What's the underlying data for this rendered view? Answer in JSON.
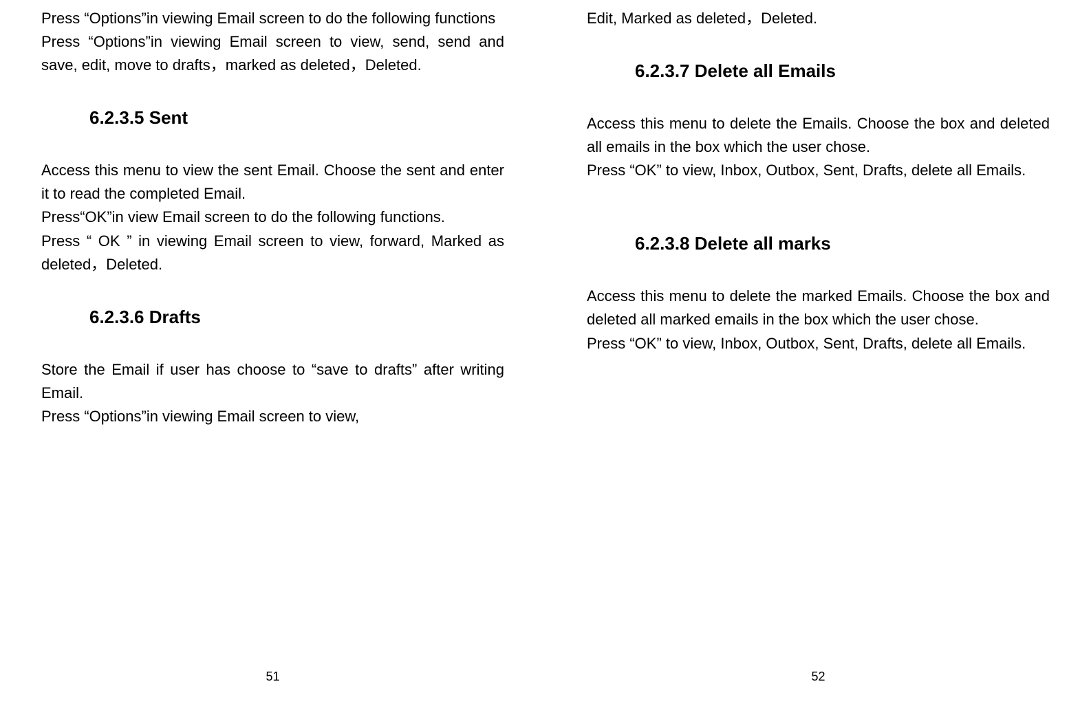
{
  "leftPage": {
    "para1": "Press “Options”in viewing Email screen to do the following functions",
    "para2": "Press “Options”in viewing Email screen to view, send, send and save, edit, move to drafts，marked as deleted，Deleted.",
    "heading1": "6.2.3.5 Sent",
    "para3": "Access this menu to view the sent Email. Choose the sent and enter it to read the completed Email.",
    "para4": "Press“OK”in view Email screen to do the following functions.",
    "para5": "Press “ OK ” in viewing Email screen to view, forward, Marked as deleted，Deleted.",
    "heading2": "6.2.3.6 Drafts",
    "para6": "Store the Email if user has choose to “save to drafts” after writing Email.",
    "para7": "Press “Options”in viewing Email screen to view,",
    "pageNumber": "51"
  },
  "rightPage": {
    "para1": "Edit, Marked as deleted，Deleted.",
    "heading1": "6.2.3.7 Delete all Emails",
    "para2": "Access this menu to delete the Emails. Choose the box and deleted all emails in the box which the user chose.",
    "para3": "Press “OK” to view, Inbox, Outbox, Sent, Drafts, delete all Emails.",
    "heading2": "6.2.3.8 Delete all marks",
    "para4": "Access this menu to delete the marked Emails. Choose the box and deleted all marked emails in the box which the user chose.",
    "para5": "Press “OK” to view, Inbox, Outbox, Sent, Drafts, delete all Emails.",
    "pageNumber": "52"
  }
}
